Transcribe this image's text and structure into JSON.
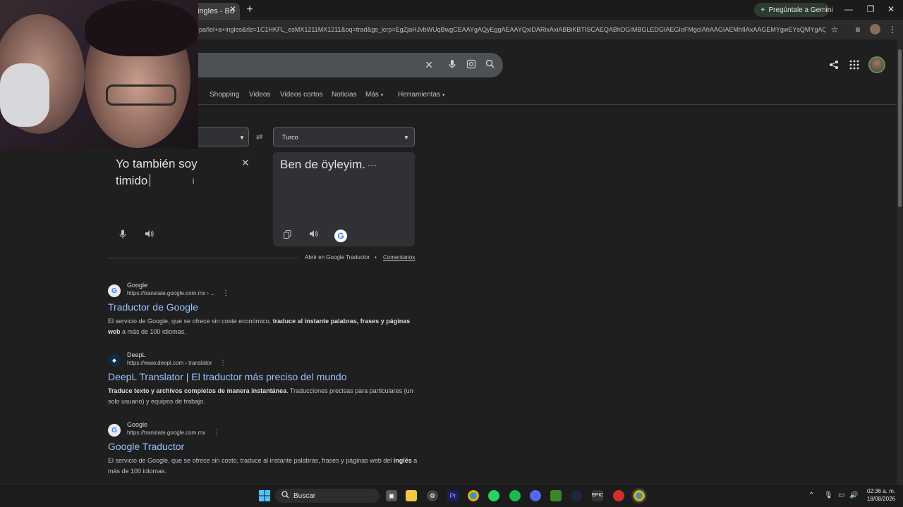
{
  "browser": {
    "tab_title": "ingles - Bu",
    "url": "pañol+a+ingles&rlz=1C1HKFL_esMX1211MX1211&oq=trad&gs_lcrp=EgZjaHJvbWUqBwgCEAAYgAQyEggAEAAYQxiDARixAxiABBiKBTISCAEQABhDGIMBGLEDGIAEGIoFMgcIAhAAGIAEMhIIAxAAGEMYgwEYsQMYgAQYi",
    "gemini_label": "Pregúntale a Gemini"
  },
  "nav_tabs": [
    "Shopping",
    "Videos",
    "Videos cortos",
    "Noticias",
    "Más",
    "Herramientas"
  ],
  "translator": {
    "target_lang": "Turco",
    "source_text_line1": "Yo también soy",
    "source_text_line2": "timido",
    "translation": "Ben de öyleyim.",
    "translation_more": "···",
    "open_link": "Abrir en Google Traductor",
    "separator": "•",
    "feedback_link": "Comentarios"
  },
  "results": [
    {
      "site": "Google",
      "url": "https://translate.google.com.mx › ...",
      "title": "Traductor de Google",
      "snippet_pre": "El servicio de Google, que se ofrece sin coste económico, ",
      "snippet_bold": "traduce al instante palabras, frases y páginas web",
      "snippet_post": " a más de 100 idiomas."
    },
    {
      "site": "DeepL",
      "url": "https://www.deepl.com › translator",
      "title": "DeepL Translator | El traductor más preciso del mundo",
      "snippet_bold": "Traduce texto y archivos completos de manera instantánea",
      "snippet_post": ". Traducciones precisas para particulares (un solo usuario) y equipos de trabajo."
    },
    {
      "site": "Google",
      "url": "https://translate.google.com.mx",
      "title": "Google Traductor",
      "snippet_pre": "El servicio de Google, que se ofrece sin costo, traduce al instante palabras, frases y páginas web del ",
      "snippet_bold": "inglés",
      "snippet_post": " a más de 100 idiomas."
    }
  ],
  "taskbar": {
    "search_label": "Buscar",
    "time": "02:36 a. m.",
    "date": "18/08/2026"
  },
  "colors": {
    "link": "#99c3ff",
    "background": "#1f1f1f"
  }
}
